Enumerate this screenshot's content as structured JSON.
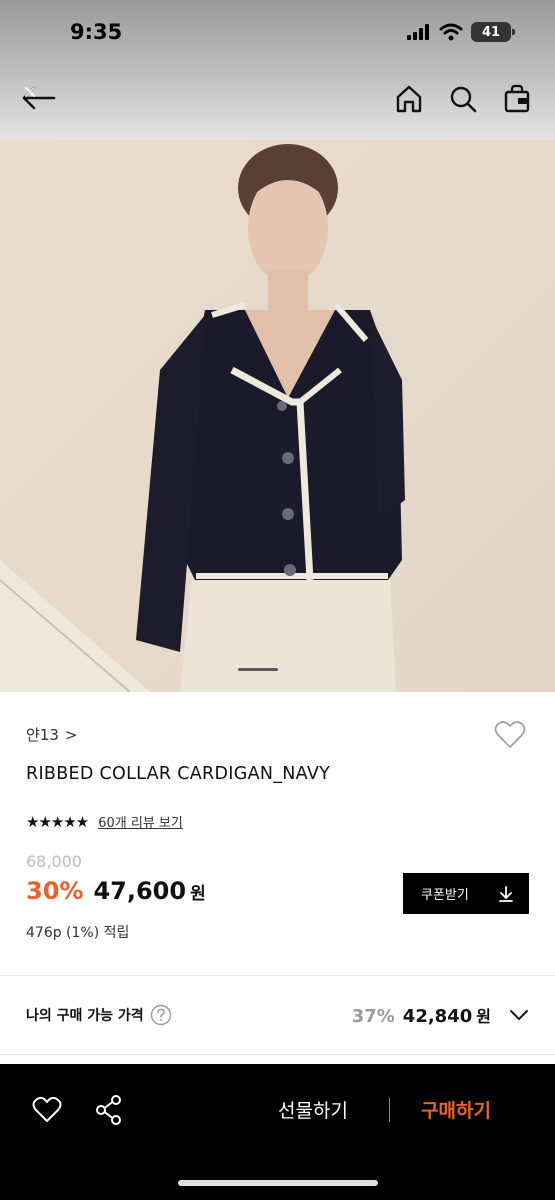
{
  "status_bar": {
    "time": "9:35",
    "battery": "41"
  },
  "nav": {
    "back_icon": "back-arrow-icon",
    "home_icon": "home-icon",
    "search_icon": "search-icon",
    "bag_icon": "shopping-bag-icon"
  },
  "product": {
    "brand": "얀13",
    "brand_chevron": ">",
    "title": "RIBBED COLLAR CARDIGAN_NAVY",
    "stars": "★★★★★",
    "review_link": "60개 리뷰 보기",
    "original_price": "68,000",
    "discount": "30%",
    "price": "47,600",
    "currency": "원",
    "points": "476p (1%) 적립",
    "coupon_label": "쿠폰받기"
  },
  "my_price": {
    "label": "나의 구매 가능 가격",
    "discount": "37%",
    "price": "42,840",
    "currency": "원"
  },
  "bottom_bar": {
    "gift_label": "선물하기",
    "buy_label": "구매하기"
  },
  "colors": {
    "accent": "#e8602c",
    "black": "#000000",
    "muted": "#9a9a9a"
  }
}
